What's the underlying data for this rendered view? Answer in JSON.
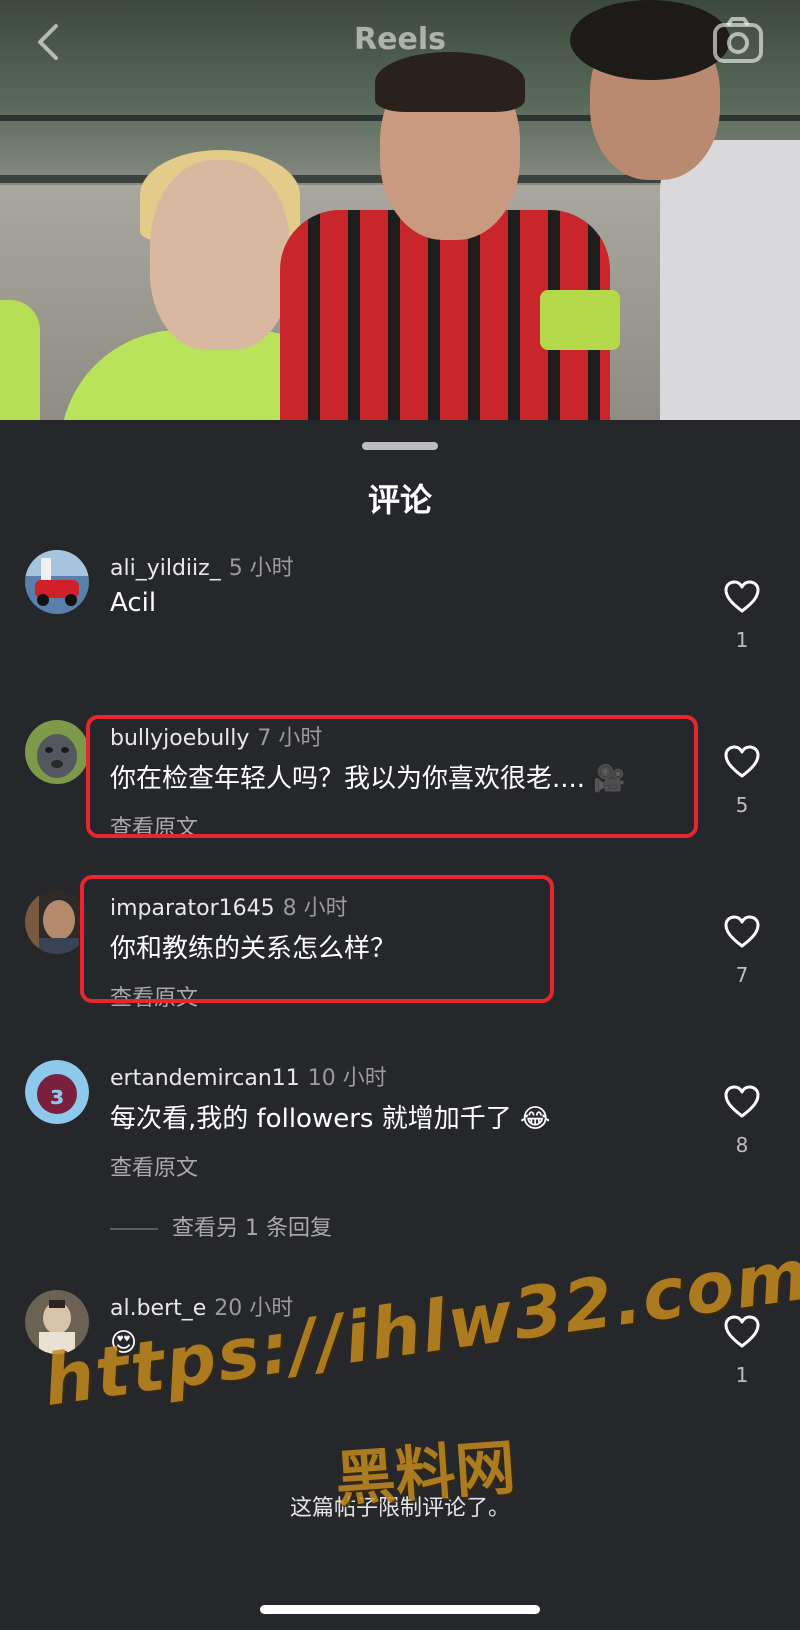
{
  "header": {
    "title": "Reels",
    "back_icon": "chevron-left-icon",
    "camera_icon": "camera-icon"
  },
  "sheet": {
    "title": "评论"
  },
  "comments": [
    {
      "username": "ali_yildiiz_",
      "time": "5 小时",
      "text": "Acil",
      "likes": "1",
      "translate": "",
      "highlighted": false
    },
    {
      "username": "bullyjoebully",
      "time": "7 小时",
      "text": "你在检查年轻人吗？我以为你喜欢很老....",
      "emoji": "🎥",
      "likes": "5",
      "translate": "查看原文",
      "highlighted": true
    },
    {
      "username": "imparator1645",
      "time": "8 小时",
      "text": "你和教练的关系怎么样？",
      "likes": "7",
      "translate": "查看原文",
      "highlighted": true
    },
    {
      "username": "ertandemircan11",
      "time": "10 小时",
      "text": "每次看,我的 followers 就增加千了",
      "emoji": "😂",
      "likes": "8",
      "translate": "查看原文",
      "highlighted": false,
      "replies": "查看另 1 条回复"
    },
    {
      "username": "al.bert_e",
      "time": "20 小时",
      "text": "😍",
      "likes": "1",
      "translate": "",
      "highlighted": false
    }
  ],
  "footer": {
    "note": "这篇帖子限制评论了。"
  },
  "watermark": {
    "line1": "https://ihlw32.com",
    "line2": "黑料网"
  },
  "colors": {
    "background": "#26272b",
    "highlight": "#e8262f",
    "watermark": "#c48a1f"
  }
}
